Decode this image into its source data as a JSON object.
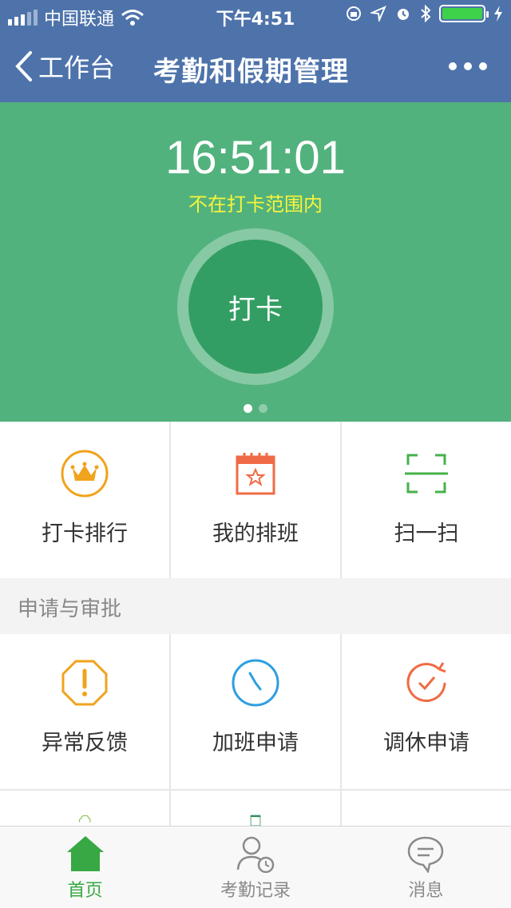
{
  "status_bar": {
    "carrier": "中国联通",
    "time": "下午4:51"
  },
  "nav": {
    "back_label": "工作台",
    "title": "考勤和假期管理"
  },
  "punch": {
    "clock": "16:51:01",
    "range_status": "不在打卡范围内",
    "button_label": "打卡",
    "page_count": 2,
    "active_page": 1
  },
  "quick_actions": [
    {
      "label": "打卡排行",
      "icon": "crown-icon",
      "color": "#f0a31c"
    },
    {
      "label": "我的排班",
      "icon": "calendar-star-icon",
      "color": "#ef6b45"
    },
    {
      "label": "扫一扫",
      "icon": "scan-icon",
      "color": "#45b24a"
    }
  ],
  "approval_section": {
    "title": "申请与审批",
    "items": [
      {
        "label": "异常反馈",
        "icon": "warning-octagon-icon",
        "color": "#f0a31c"
      },
      {
        "label": "加班申请",
        "icon": "clock-icon",
        "color": "#2e9fe0"
      },
      {
        "label": "调休申请",
        "icon": "clock-check-icon",
        "color": "#ef6b45"
      },
      {
        "label": "",
        "icon": "cloud-icon",
        "color": "#8bc34a"
      },
      {
        "label": "",
        "icon": "calendar-icon",
        "color": "#2e8b57"
      },
      {
        "label": "",
        "icon": "",
        "color": ""
      }
    ]
  },
  "tabs": [
    {
      "label": "首页",
      "icon": "home-icon",
      "active": true
    },
    {
      "label": "考勤记录",
      "icon": "user-clock-icon",
      "active": false
    },
    {
      "label": "消息",
      "icon": "message-icon",
      "active": false
    }
  ],
  "colors": {
    "header": "#4e73ab",
    "hero": "#52b27d",
    "punch_button": "#339e63",
    "warning_text": "#f7f43c",
    "tab_active": "#37a843"
  }
}
